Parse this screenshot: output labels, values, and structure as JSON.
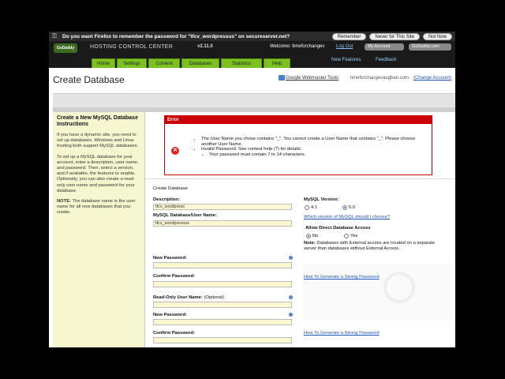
{
  "firefox_bar": {
    "message": "Do you want Firefox to remember the password for \"tfcv_wordpressus\" on secureserver.net?",
    "remember_label": "Remember",
    "never_label": "Never for This Site",
    "not_now_label": "Not Now"
  },
  "header": {
    "logo_text": "GoDaddy",
    "title": "HOSTING CONTROL CENTER",
    "version": "v2.11.0",
    "welcome": "Welcome: timeforchangev",
    "logout_label": "Log Out",
    "my_account_label": "My Account",
    "godaddy_label": "GoDaddy.com"
  },
  "nav": {
    "tabs": [
      "Home",
      "Settings",
      "Content",
      "Databases",
      "Statistics",
      "Help"
    ],
    "new_features_label": "New Features",
    "feedback_label": "Feedback"
  },
  "page": {
    "title": "Create Database",
    "webmaster_tools_label": "Google Webmaster Tools",
    "domain": "timeforchangevaughan.com",
    "change_account_label": "(Change Account)"
  },
  "sidebar": {
    "title": "Create a New MySQL Database Instructions",
    "p1": "If you have a dynamic site, you need to set up databases. Windows and Linux hosting both support MySQL databases.",
    "p2": "To set up a MySQL database for your account, enter a description, user name, and password. Then, select a version, and if available, the features to enable. Optionally, you can also create a read-only user name and password for your database.",
    "note_label": "NOTE:",
    "note_text": " The database name is the user name for all new databases that you create."
  },
  "error": {
    "heading": "Error",
    "line1": "The User Name you chose contains \"_\". You cannot create a User Name that contains \"_\". Please choose another User Name.",
    "line2": "Invalid Password. See context help (?) for details.",
    "line3": "Your password must contain 7 to 14 characters."
  },
  "form": {
    "section_title": "Create Database",
    "description_label": "Description:",
    "description_value": "tfcv_wordpress",
    "dbuser_label": "MySQL Database/User Name:",
    "dbuser_value": "tfcv_wordpressus",
    "new_password_label": "New Password:",
    "confirm_password_label": "Confirm Password:",
    "readonly_label": "Read-Only User Name:",
    "readonly_optional": "(Optional)",
    "ro_new_password_label": "New Password:",
    "ro_confirm_password_label": "Confirm Password:",
    "mysql_version_label": "MySQL Version:",
    "version_41": "4.1",
    "version_50": "5.0",
    "which_version_link": "Which version of MySQL should I choose?",
    "direct_access_label": "Allow Direct Database Access",
    "no_label": "No",
    "yes_label": "Yes",
    "direct_note_label": "Note:",
    "direct_note_text": " Databases with External access are located on a separate server than databases without External Access.",
    "strong_pw_link_1": "How To Generate a Strong Password",
    "strong_pw_link_2": "How To Generate a Strong Password"
  }
}
